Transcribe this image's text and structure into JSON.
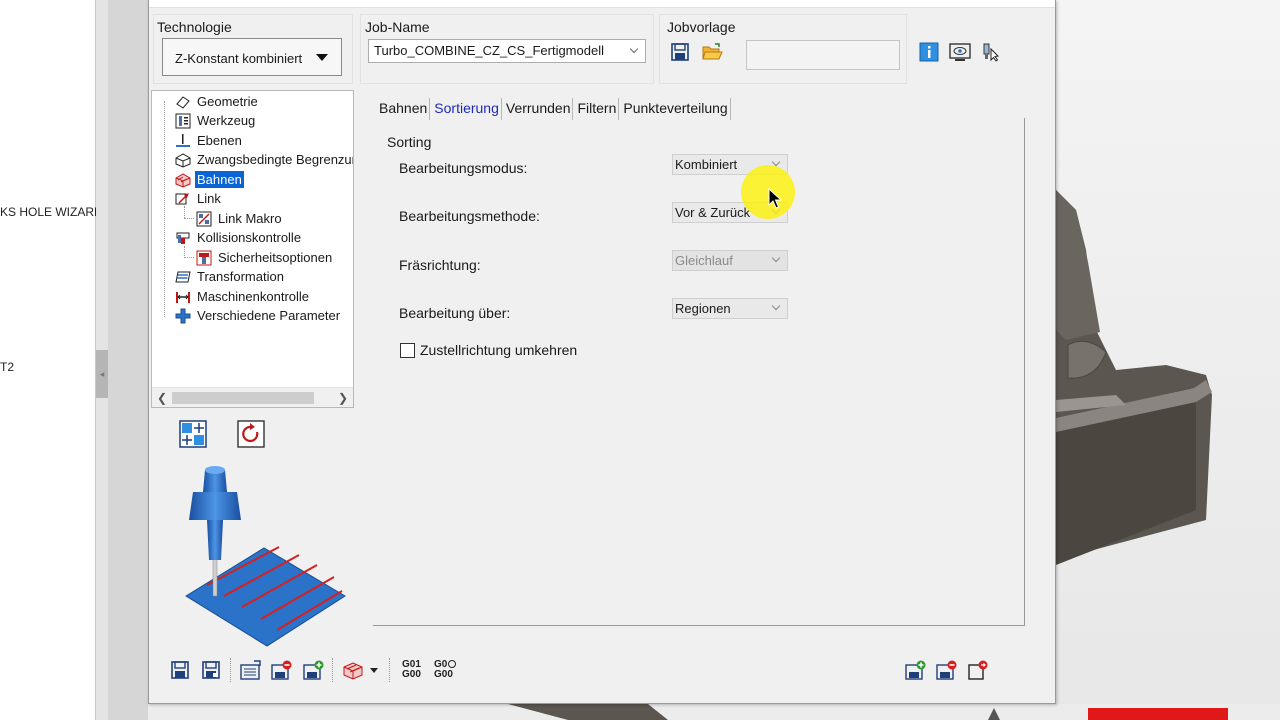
{
  "background": {
    "left_tree_texts": [
      "KS HOLE WIZARD",
      "T2"
    ]
  },
  "dialog": {
    "technologie_label": "Technologie",
    "technologie_value": "Z-Konstant kombiniert",
    "jobname_label": "Job-Name",
    "jobname_value": "Turbo_COMBINE_CZ_CS_Fertigmodell",
    "jobvorlage_label": "Jobvorlage",
    "jobvorlage_value": "",
    "tree": [
      {
        "label": "Geometrie",
        "icon": "geometry-icon"
      },
      {
        "label": "Werkzeug",
        "icon": "tool-icon"
      },
      {
        "label": "Ebenen",
        "icon": "planes-icon"
      },
      {
        "label": "Zwangsbedingte Begrenzung",
        "icon": "constraint-icon"
      },
      {
        "label": "Bahnen",
        "icon": "toolpath-icon",
        "selected": true
      },
      {
        "label": "Link",
        "icon": "link-icon"
      },
      {
        "label": "Link Makro",
        "icon": "link-macro-icon",
        "child": true
      },
      {
        "label": "Kollisionskontrolle",
        "icon": "collision-icon"
      },
      {
        "label": "Sicherheitsoptionen",
        "icon": "safety-icon",
        "child": true
      },
      {
        "label": "Transformation",
        "icon": "transformation-icon"
      },
      {
        "label": "Maschinenkontrolle",
        "icon": "machine-control-icon"
      },
      {
        "label": "Verschiedene Parameter",
        "icon": "misc-params-icon"
      }
    ],
    "tabs": [
      "Bahnen",
      "Sortierung",
      "Verrunden",
      "Filtern",
      "Punkteverteilung"
    ],
    "active_tab": "Sortierung",
    "sorting": {
      "title": "Sorting",
      "fields": [
        {
          "label": "Bearbeitungsmodus:",
          "value": "Kombiniert",
          "enabled": true
        },
        {
          "label": "Bearbeitungsmethode:",
          "value": "Vor & Zurück",
          "enabled": true
        },
        {
          "label": "Fräsrichtung:",
          "value": "Gleichlauf",
          "enabled": false
        },
        {
          "label": "Bearbeitung über:",
          "value": "Regionen",
          "enabled": true
        }
      ],
      "checkbox_label": "Zustellrichtung umkehren",
      "checkbox_checked": false
    },
    "gcode_buttons": [
      {
        "top": "G01",
        "bottom": "G00"
      },
      {
        "top": "G0",
        "bottom": "G00"
      }
    ]
  },
  "colors": {
    "selection": "#0a64d6",
    "active_tab": "#1d2ab8",
    "cursor_highlight": "#fff200",
    "preview_blue": "#2a73c8",
    "preview_red": "#d42020"
  }
}
